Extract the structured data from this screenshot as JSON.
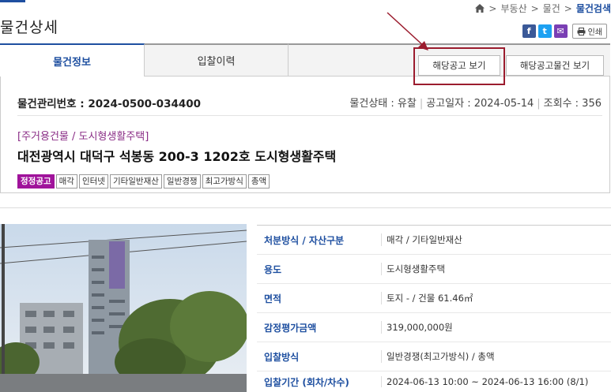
{
  "header": {
    "page_title": "물건상세",
    "breadcrumb": [
      "부동산",
      "물건"
    ],
    "breadcrumb_current": "물건검색",
    "breadcrumb_sep": ">",
    "share": {
      "facebook": "f",
      "twitter": "t",
      "mail": "✉",
      "print_label": "인쇄"
    }
  },
  "tabs": [
    {
      "label": "물건정보",
      "active": true
    },
    {
      "label": "입찰이력",
      "active": false
    }
  ],
  "buttons": {
    "notice": "해당공고 보기",
    "notice_items": "해당공고물건 보기"
  },
  "summary": {
    "mgmt_no": "물건관리번호 : 2024-0500-034400",
    "status": "물건상태 : 유찰",
    "notice_date": "공고일자 : 2024-05-14",
    "views": "조회수 : 356",
    "category": "[주거용건물 / 도시형생활주택]",
    "address": "대전광역시 대덕구 석봉동 200-3 1202호 도시형생활주택",
    "tags": [
      "정정공고",
      "매각",
      "인터넷",
      "기타일반재산",
      "일반경쟁",
      "최고가방식",
      "총액"
    ]
  },
  "details": [
    {
      "label": "처분방식 / 자산구분",
      "value": "매각 / 기타일반재산"
    },
    {
      "label": "용도",
      "value": "도시형생활주택"
    },
    {
      "label": "면적",
      "value": "토지 - / 건물 61.46㎡"
    },
    {
      "label": "감정평가금액",
      "value": "319,000,000원"
    },
    {
      "label": "입찰방식",
      "value": "일반경쟁(최고가방식) / 총액"
    },
    {
      "label": "입찰기간 (회차/차수)",
      "value": "2024-06-13 10:00 ~ 2024-06-13 16:00 (8/1)"
    }
  ],
  "colors": {
    "accent": "#1e4fa0",
    "highlight": "#9b1c2e",
    "tag_primary": "#a0139b",
    "category": "#8a2d86"
  }
}
